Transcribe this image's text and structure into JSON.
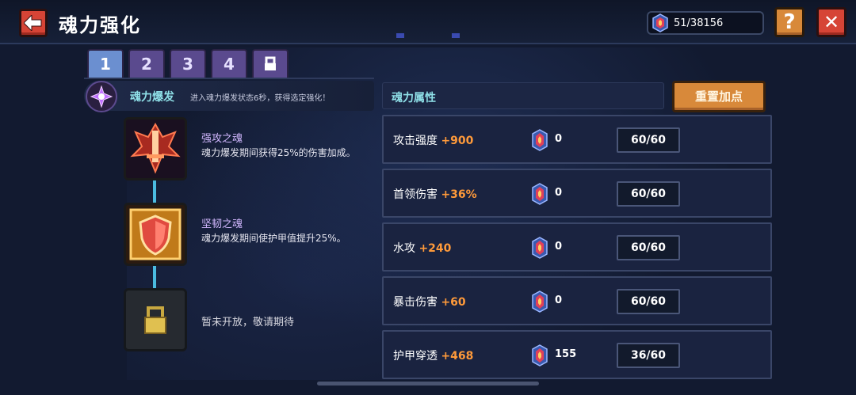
{
  "header": {
    "title": "魂力强化",
    "currency_text": "51/38156",
    "help_label": "?",
    "close_label": "✕"
  },
  "tabs": [
    {
      "label": "1",
      "active": true
    },
    {
      "label": "2",
      "active": false
    },
    {
      "label": "3",
      "active": false
    },
    {
      "label": "4",
      "active": false
    },
    {
      "label": "",
      "icon": "lock-icon",
      "active": false
    }
  ],
  "burst": {
    "title": "魂力爆发",
    "desc": "进入魂力爆发状态6秒，获得选定强化！"
  },
  "skills": [
    {
      "name": "强攻之魂",
      "desc": "魂力爆发期间获得25%的伤害加成。",
      "icon": "sword-emblem-icon"
    },
    {
      "name": "坚韧之魂",
      "desc": "魂力爆发期间使护甲值提升25%。",
      "icon": "shield-icon"
    },
    {
      "locked_text": "暂未开放，敬请期待",
      "icon": "padlock-icon"
    }
  ],
  "attributes": {
    "title": "魂力属性",
    "reset_label": "重置加点",
    "rows": [
      {
        "label": "攻击强度",
        "bonus": "+900",
        "cost": "0",
        "level": "60/60"
      },
      {
        "label": "首领伤害",
        "bonus": "+36%",
        "cost": "0",
        "level": "60/60"
      },
      {
        "label": "水攻",
        "bonus": "+240",
        "cost": "0",
        "level": "60/60"
      },
      {
        "label": "暴击伤害",
        "bonus": "+60",
        "cost": "0",
        "level": "60/60"
      },
      {
        "label": "护甲穿透",
        "bonus": "+468",
        "cost": "155",
        "level": "36/60"
      }
    ]
  },
  "colors": {
    "accent_cyan": "#8fe0e8",
    "bonus_orange": "#ff9a3a",
    "button_orange": "#d8893a",
    "button_red": "#d64436",
    "tab_purple": "#5a4a8e",
    "tab_active": "#6b8fd0"
  }
}
